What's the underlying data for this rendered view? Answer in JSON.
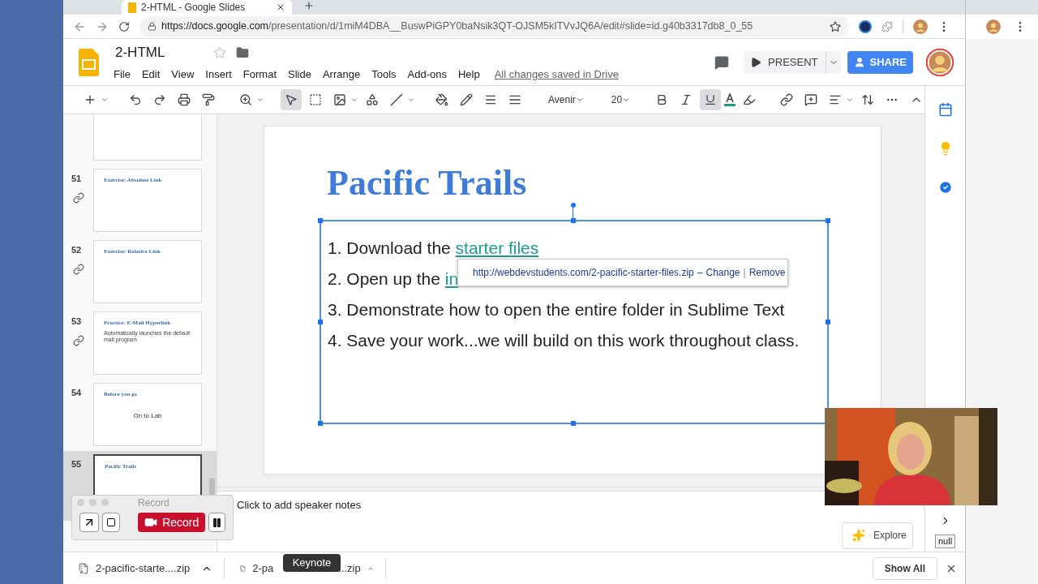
{
  "browser": {
    "tab_title": "2-HTML - Google Slides",
    "url_host": "https://docs.google.com",
    "url_path": "/presentation/d/1miM4DBA__BuswPiGPY0baNsik3QT-OJSM5kITVvJQ6A/edit#slide=id.g40b3317db8_0_55"
  },
  "document": {
    "title": "2-HTML",
    "menu": [
      "File",
      "Edit",
      "View",
      "Insert",
      "Format",
      "Slide",
      "Arrange",
      "Tools",
      "Add-ons",
      "Help"
    ],
    "save_status": "All changes saved in Drive",
    "present_label": "PRESENT",
    "share_label": "SHARE"
  },
  "toolbar": {
    "select_tool": {
      "selected": true
    },
    "font": "Avenir",
    "font_size": "20",
    "underline": {
      "on": true
    }
  },
  "filmstrip": [
    {
      "selected": false
    },
    {
      "number": "51",
      "linked": true,
      "selected": false,
      "title": "Exercise: Absolute Link"
    },
    {
      "number": "52",
      "linked": true,
      "selected": false,
      "title": "Exercise: Relative Link"
    },
    {
      "number": "53",
      "linked": true,
      "selected": false,
      "title": "Practice: E-Mail Hyperlink",
      "lines": [
        {
          "kind": "large",
          "text": "Automatically launches the default mail program"
        }
      ]
    },
    {
      "number": "54",
      "linked": false,
      "selected": false,
      "title": "Before you go",
      "lines": [
        {
          "kind": "center",
          "text": "On to Lab"
        }
      ]
    },
    {
      "number": "55",
      "linked": false,
      "selected": true,
      "title": "Pacific Trails"
    }
  ],
  "slide": {
    "title": "Pacific Trails",
    "items": [
      {
        "text": "1. Download the ",
        "link": "starter files"
      },
      {
        "text": "2. Open up the ",
        "link": "in"
      },
      {
        "text": "3. Demonstrate how to open the entire folder in Sublime Text"
      },
      {
        "text": "4. Save your work...we will build on this work throughout class."
      }
    ],
    "link_popup": {
      "url": "http://webdevstudents.com/2-pacific-starter-files.zip",
      "separator": "–",
      "change": "Change",
      "divider": "|",
      "remove": "Remove"
    }
  },
  "speaker_notes": "Click to add speaker notes",
  "explore_label": "Explore",
  "record_window": {
    "title": "Record",
    "record_label": "Record"
  },
  "downloads": [
    {
      "name_start": "2-pacific-starte....zip"
    },
    {
      "name_start": "2-pa",
      "name_end": "...zip"
    }
  ],
  "show_all": "Show All",
  "tooltips": {
    "keynote": "Keynote",
    "side": "null"
  }
}
